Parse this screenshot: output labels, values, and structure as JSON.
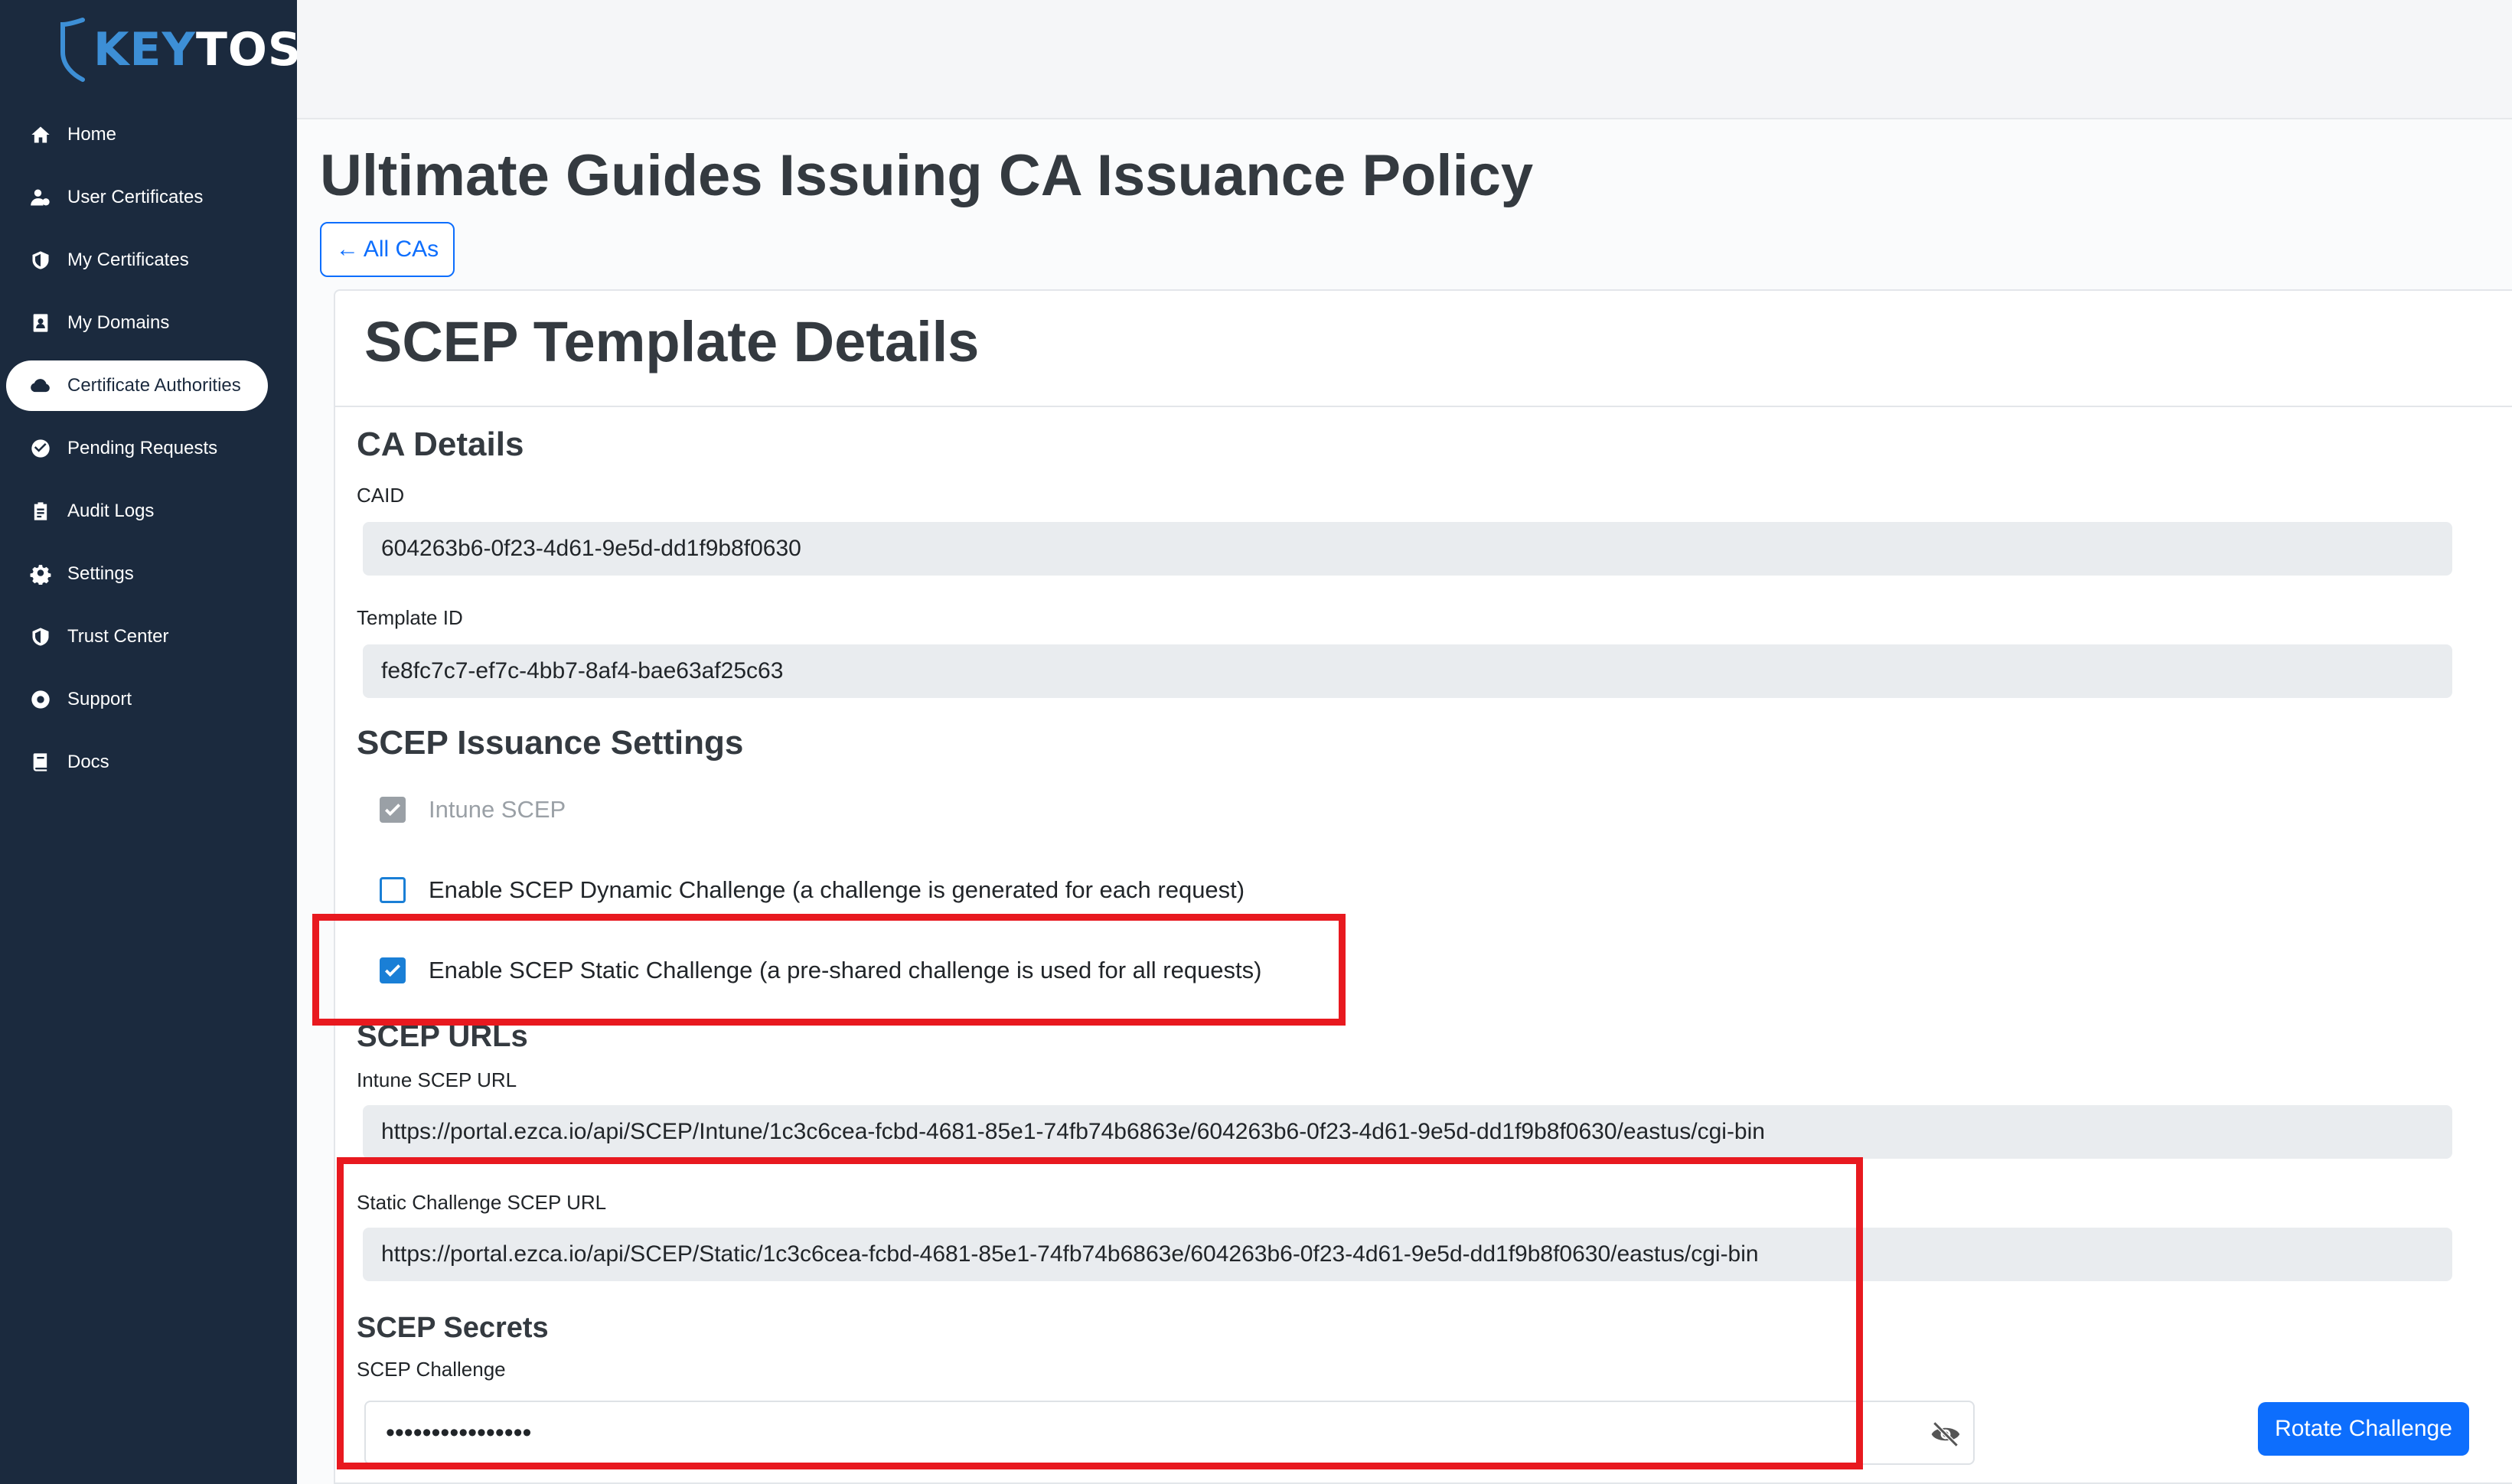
{
  "brand": {
    "logo_prefix": "KEY",
    "logo_suffix": "TOS"
  },
  "sidebar": {
    "items": [
      {
        "label": "Home",
        "icon": "home-icon"
      },
      {
        "label": "User Certificates",
        "icon": "user-certificate-icon"
      },
      {
        "label": "My Certificates",
        "icon": "shield-icon"
      },
      {
        "label": "My Domains",
        "icon": "id-card-icon"
      },
      {
        "label": "Certificate Authorities",
        "icon": "cloud-icon",
        "active": true
      },
      {
        "label": "Pending Requests",
        "icon": "check-circle-icon"
      },
      {
        "label": "Audit Logs",
        "icon": "clipboard-icon"
      },
      {
        "label": "Settings",
        "icon": "gear-icon"
      },
      {
        "label": "Trust Center",
        "icon": "shield-icon"
      },
      {
        "label": "Support",
        "icon": "life-ring-icon"
      },
      {
        "label": "Docs",
        "icon": "book-icon"
      }
    ]
  },
  "page": {
    "title": "Ultimate Guides Issuing CA Issuance Policy",
    "back_label": "All CAs"
  },
  "card": {
    "title": "SCEP Template Details",
    "ca_details": {
      "heading": "CA Details",
      "caid_label": "CAID",
      "caid_value": "604263b6-0f23-4d61-9e5d-dd1f9b8f0630",
      "template_label": "Template ID",
      "template_value": "fe8fc7c7-ef7c-4bb7-8af4-bae63af25c63"
    },
    "issuance": {
      "heading": "SCEP Issuance Settings",
      "intune_label": "Intune SCEP",
      "intune_checked": true,
      "dynamic_label": "Enable SCEP Dynamic Challenge (a challenge is generated for each request)",
      "dynamic_checked": false,
      "static_label": "Enable SCEP Static Challenge (a pre-shared challenge is used for all requests)",
      "static_checked": true
    },
    "urls": {
      "heading": "SCEP URLs",
      "intune_label": "Intune SCEP URL",
      "intune_value": "https://portal.ezca.io/api/SCEP/Intune/1c3c6cea-fcbd-4681-85e1-74fb74b6863e/604263b6-0f23-4d61-9e5d-dd1f9b8f0630/eastus/cgi-bin",
      "static_label": "Static Challenge SCEP URL",
      "static_value": "https://portal.ezca.io/api/SCEP/Static/1c3c6cea-fcbd-4681-85e1-74fb74b6863e/604263b6-0f23-4d61-9e5d-dd1f9b8f0630/eastus/cgi-bin"
    },
    "secrets": {
      "heading": "SCEP Secrets",
      "challenge_label": "SCEP Challenge",
      "challenge_value": "••••••••••••••••",
      "rotate_label": "Rotate Challenge"
    }
  },
  "colors": {
    "sidebar_bg": "#1b2a3e",
    "accent": "#0d6efd",
    "checkbox": "#1a7fd6",
    "highlight": "#e8191f"
  }
}
